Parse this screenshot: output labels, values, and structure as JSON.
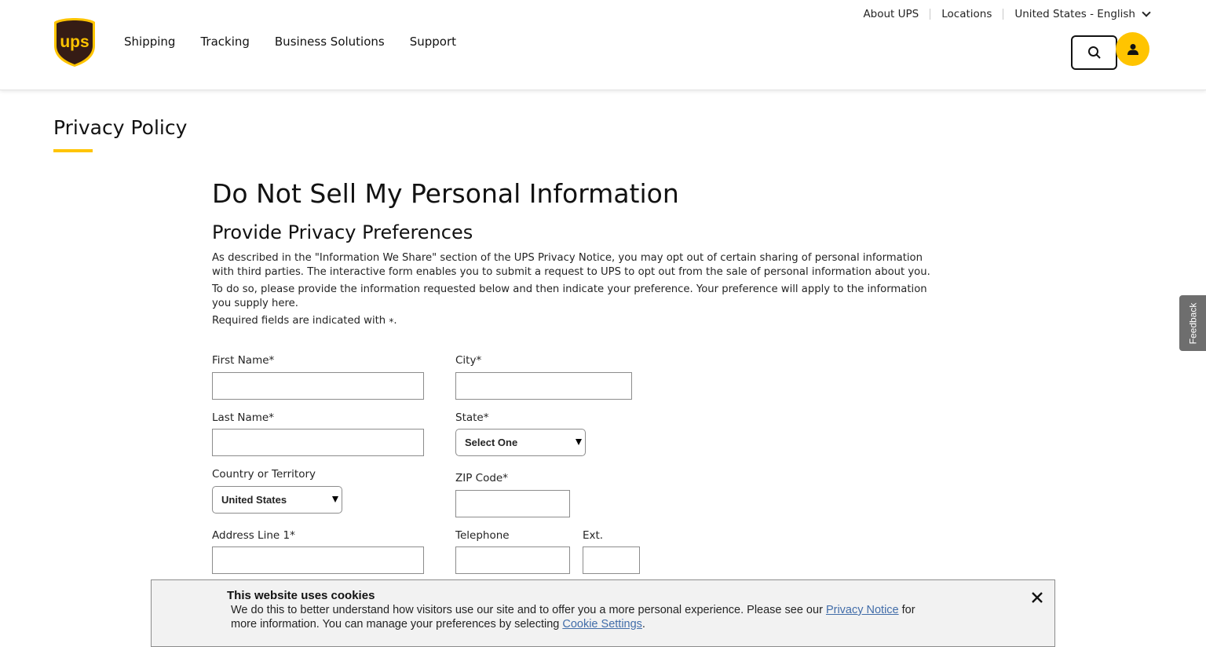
{
  "header": {
    "logo_text": "ups",
    "nav": [
      "Shipping",
      "Tracking",
      "Business Solutions",
      "Support"
    ],
    "util": {
      "about": "About UPS",
      "locations": "Locations",
      "language": "United States - English"
    }
  },
  "page": {
    "title": "Privacy Policy",
    "heading": "Do Not Sell My Personal Information",
    "subheading": "Provide Privacy Preferences",
    "para1": "As described in the \"Information We Share\" section of the UPS Privacy Notice, you may opt out of certain sharing of personal information with third parties.  The interactive form enables you to submit a request to UPS to opt out from the sale of personal information about you.",
    "para2": "To do so, please provide the information requested below and then indicate your preference. Your preference will apply to the information you supply here.",
    "para3": "Required fields are indicated with",
    "para3_star": "*",
    "para3_end": "."
  },
  "form": {
    "first_name_label": "First Name*",
    "last_name_label": "Last Name*",
    "country_label": "Country or Territory",
    "country_value": "United States",
    "address1_label": "Address Line 1*",
    "city_label": "City*",
    "state_label": "State*",
    "state_value": "Select One",
    "zip_label": "ZIP Code*",
    "telephone_label": "Telephone",
    "ext_label": "Ext."
  },
  "feedback_label": "Feedback",
  "cookie": {
    "title": "This website uses cookies",
    "text_before": "We do this to better understand how visitors use our site and to offer you a more personal experience. Please see our ",
    "privacy_link": "Privacy Notice",
    "text_middle": " for more information. You can manage your preferences by selecting ",
    "settings_link": "Cookie Settings",
    "text_end": "."
  },
  "colors": {
    "brand_yellow": "#ffc400",
    "brand_brown": "#351c15",
    "link": "#426da9"
  }
}
